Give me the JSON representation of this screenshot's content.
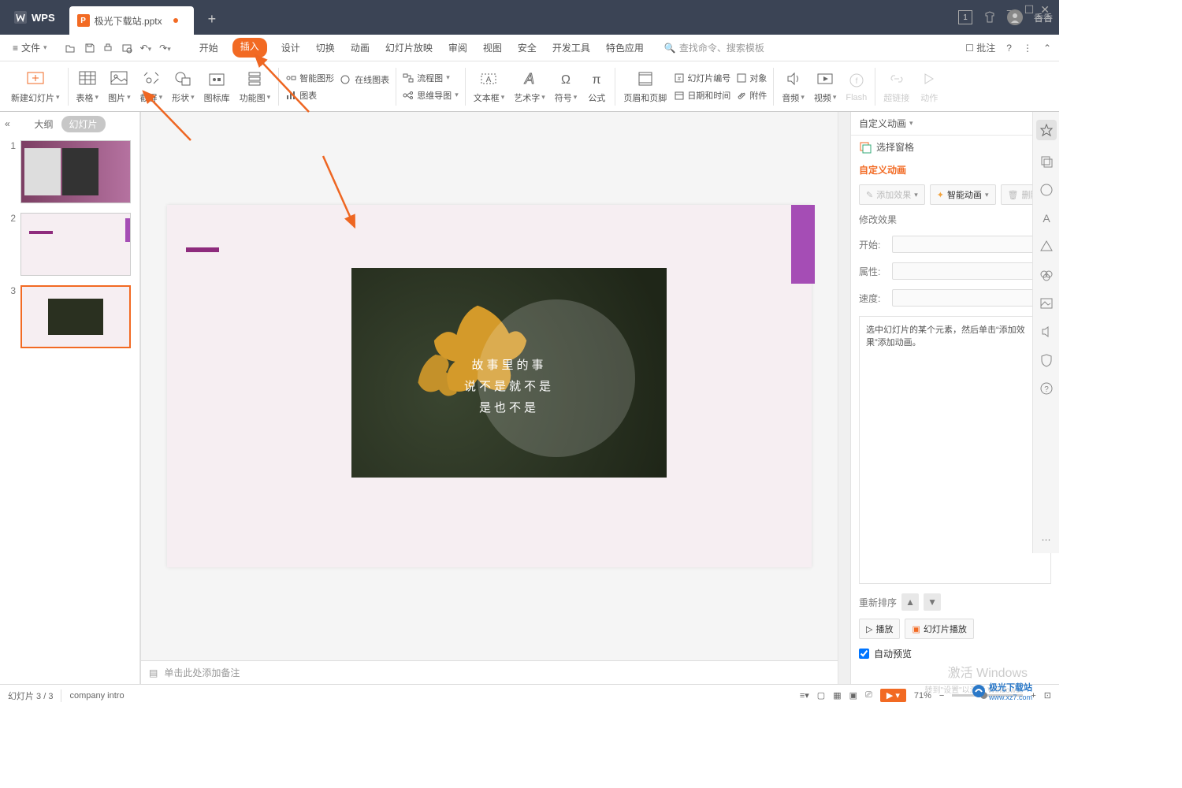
{
  "app": {
    "name": "WPS",
    "user": "香香"
  },
  "tabs": {
    "document": "极光下载站.pptx",
    "modified": true
  },
  "window": {
    "min": "—",
    "max": "☐",
    "close": "✕"
  },
  "menu": {
    "file": "文件",
    "items": [
      "开始",
      "插入",
      "设计",
      "切换",
      "动画",
      "幻灯片放映",
      "审阅",
      "视图",
      "安全",
      "开发工具",
      "特色应用"
    ],
    "active": "插入",
    "search": "查找命令、搜索模板",
    "pizhu": "批注"
  },
  "ribbon": {
    "new_slide": "新建幻灯片",
    "table": "表格",
    "picture": "图片",
    "screenshot": "截屏",
    "shape": "形状",
    "icon_lib": "图标库",
    "func_pic": "功能图",
    "smart_art": "智能图形",
    "online_chart": "在线图表",
    "chart": "图表",
    "flowchart": "流程图",
    "mindmap": "思维导图",
    "textbox": "文本框",
    "wordart": "艺术字",
    "symbol": "符号",
    "formula": "公式",
    "header_footer": "页眉和页脚",
    "slide_num": "幻灯片编号",
    "date_time": "日期和时间",
    "object": "对象",
    "attachment": "附件",
    "audio": "音频",
    "video": "视频",
    "flash": "Flash",
    "hyperlink": "超链接",
    "action": "动作"
  },
  "left": {
    "outline": "大纲",
    "slides": "幻灯片"
  },
  "slide_image": {
    "line1": "故事里的事",
    "line2": "说不是就不是",
    "line3": "是也不是"
  },
  "notes": {
    "placeholder": "单击此处添加备注"
  },
  "panel": {
    "title": "自定义动画",
    "select_pane": "选择窗格",
    "section": "自定义动画",
    "add_effect": "添加效果",
    "smart_anim": "智能动画",
    "delete": "删除",
    "modify": "修改效果",
    "start": "开始:",
    "property": "属性:",
    "speed": "速度:",
    "hint": "选中幻灯片的某个元素，然后单击“添加效果”添加动画。",
    "reorder": "重新排序",
    "play": "播放",
    "slideshow": "幻灯片播放",
    "autopreview": "自动预览"
  },
  "status": {
    "slide": "幻灯片 3 / 3",
    "template": "company intro",
    "zoom": "71%"
  },
  "watermark": {
    "l1": "激活 Windows",
    "l2": "转到\"设置\"以激活 Windows。",
    "brand": "极光下载站",
    "url": "www.xz7.com"
  }
}
